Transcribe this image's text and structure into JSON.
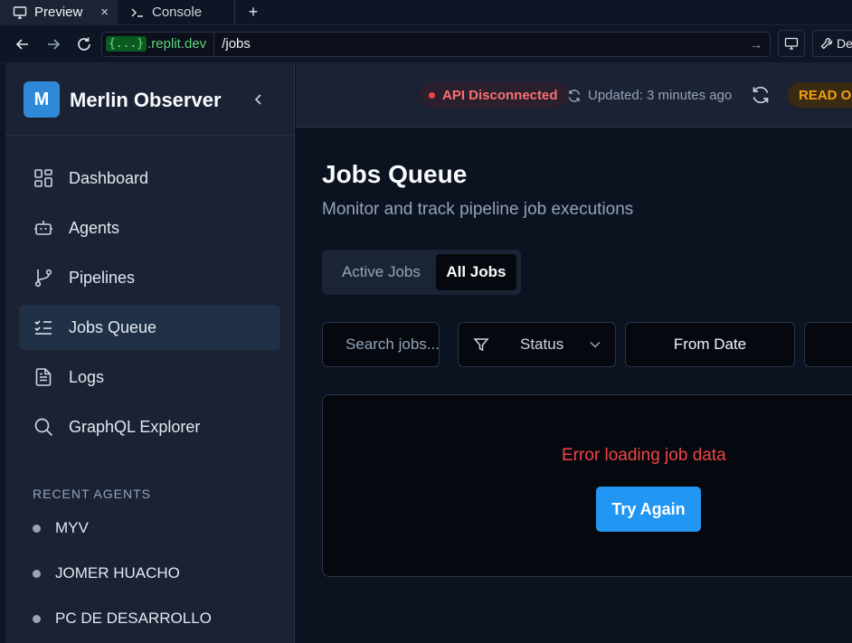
{
  "browser": {
    "tabs": [
      {
        "label": "Preview",
        "icon": "monitor-icon",
        "active": true
      },
      {
        "label": "Console",
        "icon": "terminal-icon",
        "active": false
      }
    ],
    "close_glyph": "×",
    "new_tab_glyph": "+",
    "url_badge": "{...}",
    "url_domain": ".replit.dev",
    "url_path": "/jobs",
    "dev_button_label": "De"
  },
  "sidebar": {
    "brand_initial": "M",
    "brand_name": "Merlin Observer",
    "nav": [
      {
        "label": "Dashboard",
        "icon": "dashboard-grid-icon"
      },
      {
        "label": "Agents",
        "icon": "robot-icon"
      },
      {
        "label": "Pipelines",
        "icon": "git-branch-icon"
      },
      {
        "label": "Jobs Queue",
        "icon": "list-checks-icon",
        "active": true
      },
      {
        "label": "Logs",
        "icon": "file-text-icon"
      },
      {
        "label": "GraphQL Explorer",
        "icon": "search-icon"
      }
    ],
    "recent_heading": "RECENT AGENTS",
    "recent_agents": [
      "MYV",
      "JOMER HUACHO",
      "PC DE DESARROLLO"
    ]
  },
  "header": {
    "api_status": "API Disconnected",
    "updated_text": "Updated: 3 minutes ago",
    "mode_badge": "READ ON"
  },
  "main": {
    "title": "Jobs Queue",
    "subtitle": "Monitor and track pipeline job executions",
    "tabs": [
      {
        "label": "Active Jobs",
        "active": false
      },
      {
        "label": "All Jobs",
        "active": true
      }
    ],
    "filters": {
      "search_placeholder": "Search jobs...",
      "status_label": "Status",
      "from_date_label": "From Date"
    },
    "error_message": "Error loading job data",
    "retry_label": "Try Again"
  },
  "colors": {
    "accent": "#2196f3",
    "error": "#ef4444",
    "warning": "#f59e0b",
    "brand": "#2f89d8"
  }
}
